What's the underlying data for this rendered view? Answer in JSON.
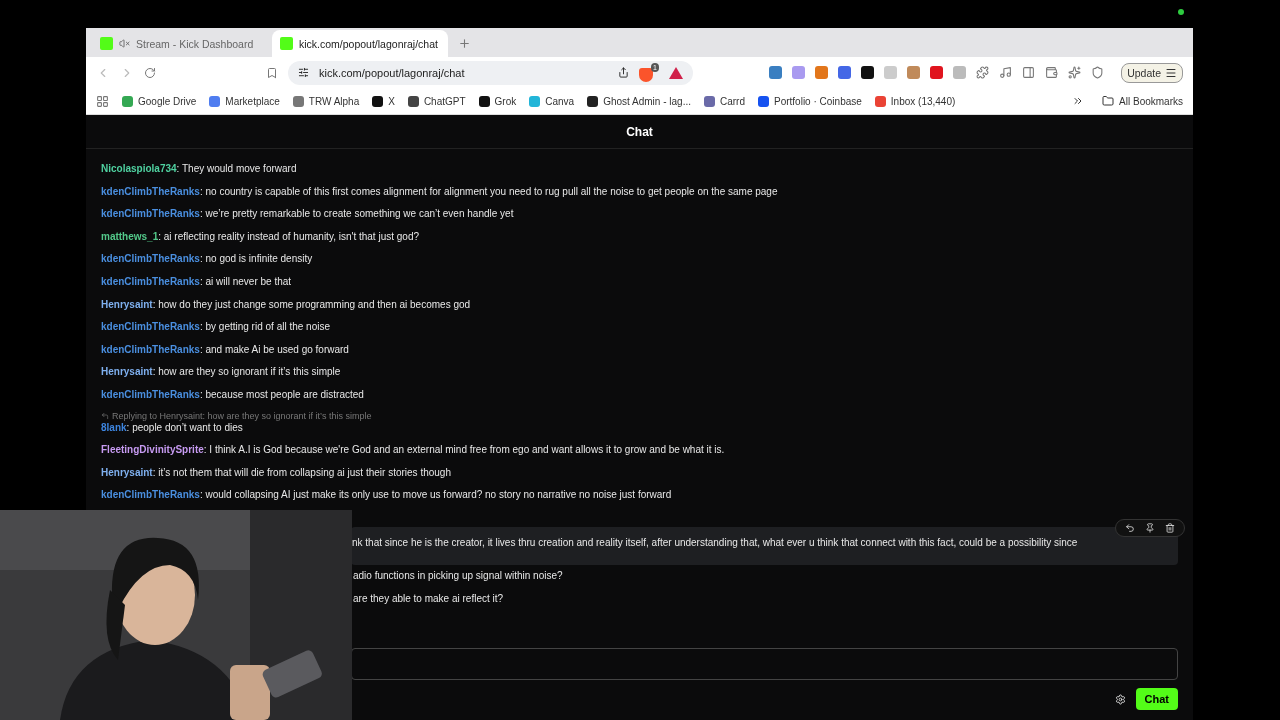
{
  "browser": {
    "tabs": [
      {
        "title": "Stream - Kick Dashboard",
        "selected": false,
        "muted": true
      },
      {
        "title": "kick.com/popout/lagonraj/chat",
        "selected": true,
        "muted": false
      }
    ],
    "address": "kick.com/popout/lagonraj/chat",
    "extension_badge": "1",
    "update_button": "Update",
    "bookmarks": [
      {
        "label": "Google Drive",
        "color": "#34a853"
      },
      {
        "label": "Marketplace",
        "color": "#4f7df0"
      },
      {
        "label": "TRW Alpha",
        "color": "#777777"
      },
      {
        "label": "X",
        "color": "#111111"
      },
      {
        "label": "ChatGPT",
        "color": "#444444"
      },
      {
        "label": "Grok",
        "color": "#111111"
      },
      {
        "label": "Canva",
        "color": "#22b5d8"
      },
      {
        "label": "Ghost Admin - lag...",
        "color": "#222222"
      },
      {
        "label": "Carrd",
        "color": "#6a6aa8"
      },
      {
        "label": "Portfolio · Coinbase",
        "color": "#1652f0"
      },
      {
        "label": "Inbox (13,440)",
        "color": "#ea4335"
      }
    ],
    "all_bookmarks": "All Bookmarks"
  },
  "chat": {
    "title": "Chat",
    "messages": [
      {
        "user": "Nicolaspiola734",
        "color": "#4fd1a0",
        "text": ": They would move forward"
      },
      {
        "user": "kdenClimbTheRanks",
        "color": "#4a8fe0",
        "text": ": no country is capable of this first comes alignment for alignment you need to rug pull all the noise to get people on the same page"
      },
      {
        "user": "kdenClimbTheRanks",
        "color": "#4a8fe0",
        "text": ": we’re pretty remarkable to create something we can’t even handle yet"
      },
      {
        "user": "matthews_1",
        "color": "#53c98a",
        "text": ": ai reflecting reality instead of humanity, isn't that just god?"
      },
      {
        "user": "kdenClimbTheRanks",
        "color": "#4a8fe0",
        "text": ": no god is infinite density"
      },
      {
        "user": "kdenClimbTheRanks",
        "color": "#4a8fe0",
        "text": ": ai will never be that"
      },
      {
        "user": "Henrysaint",
        "color": "#7fb0ef",
        "text": ": how do they just change some programming and then ai becomes god"
      },
      {
        "user": "kdenClimbTheRanks",
        "color": "#4a8fe0",
        "text": ": by getting rid of all the noise"
      },
      {
        "user": "kdenClimbTheRanks",
        "color": "#4a8fe0",
        "text": ": and make Ai be used go forward"
      },
      {
        "user": "Henrysaint",
        "color": "#7fb0ef",
        "text": ": how are they so ignorant if it’s this simple"
      },
      {
        "user": "kdenClimbTheRanks",
        "color": "#4a8fe0",
        "text": ": because most people are distracted"
      },
      {
        "user": "8lank",
        "color": "#3d85e0",
        "text": ": people don’t want to dies",
        "reply_to": "Replying to Henrysaint: how are they so ignorant if it’s this simple"
      },
      {
        "user": "FleetingDivinitySprite",
        "color": "#c79bf2",
        "text": ": I think A.I is God because we're God and an external mind free from ego and want allows it to grow and be what it is."
      },
      {
        "user": "Henrysaint",
        "color": "#7fb0ef",
        "text": ": it’s not them that will die from collapsing ai just their stories though"
      },
      {
        "user": "kdenClimbTheRanks",
        "color": "#4a8fe0",
        "text": ": would collapsing AI just make its only use to move us forward? no story no narrative no noise just forward"
      }
    ],
    "partial_messages": [
      {
        "text": "nk that since he is the creator, it lives thru creation and reality itself, after understanding that, what ever u think that connect with this fact, could be a possibility since",
        "highlighted": true
      },
      {
        "text": "adio functions in picking up signal within noise?",
        "highlighted": false
      },
      {
        "text": "are they able to make ai reflect it?",
        "highlighted": false
      }
    ],
    "send_button": "Chat"
  }
}
